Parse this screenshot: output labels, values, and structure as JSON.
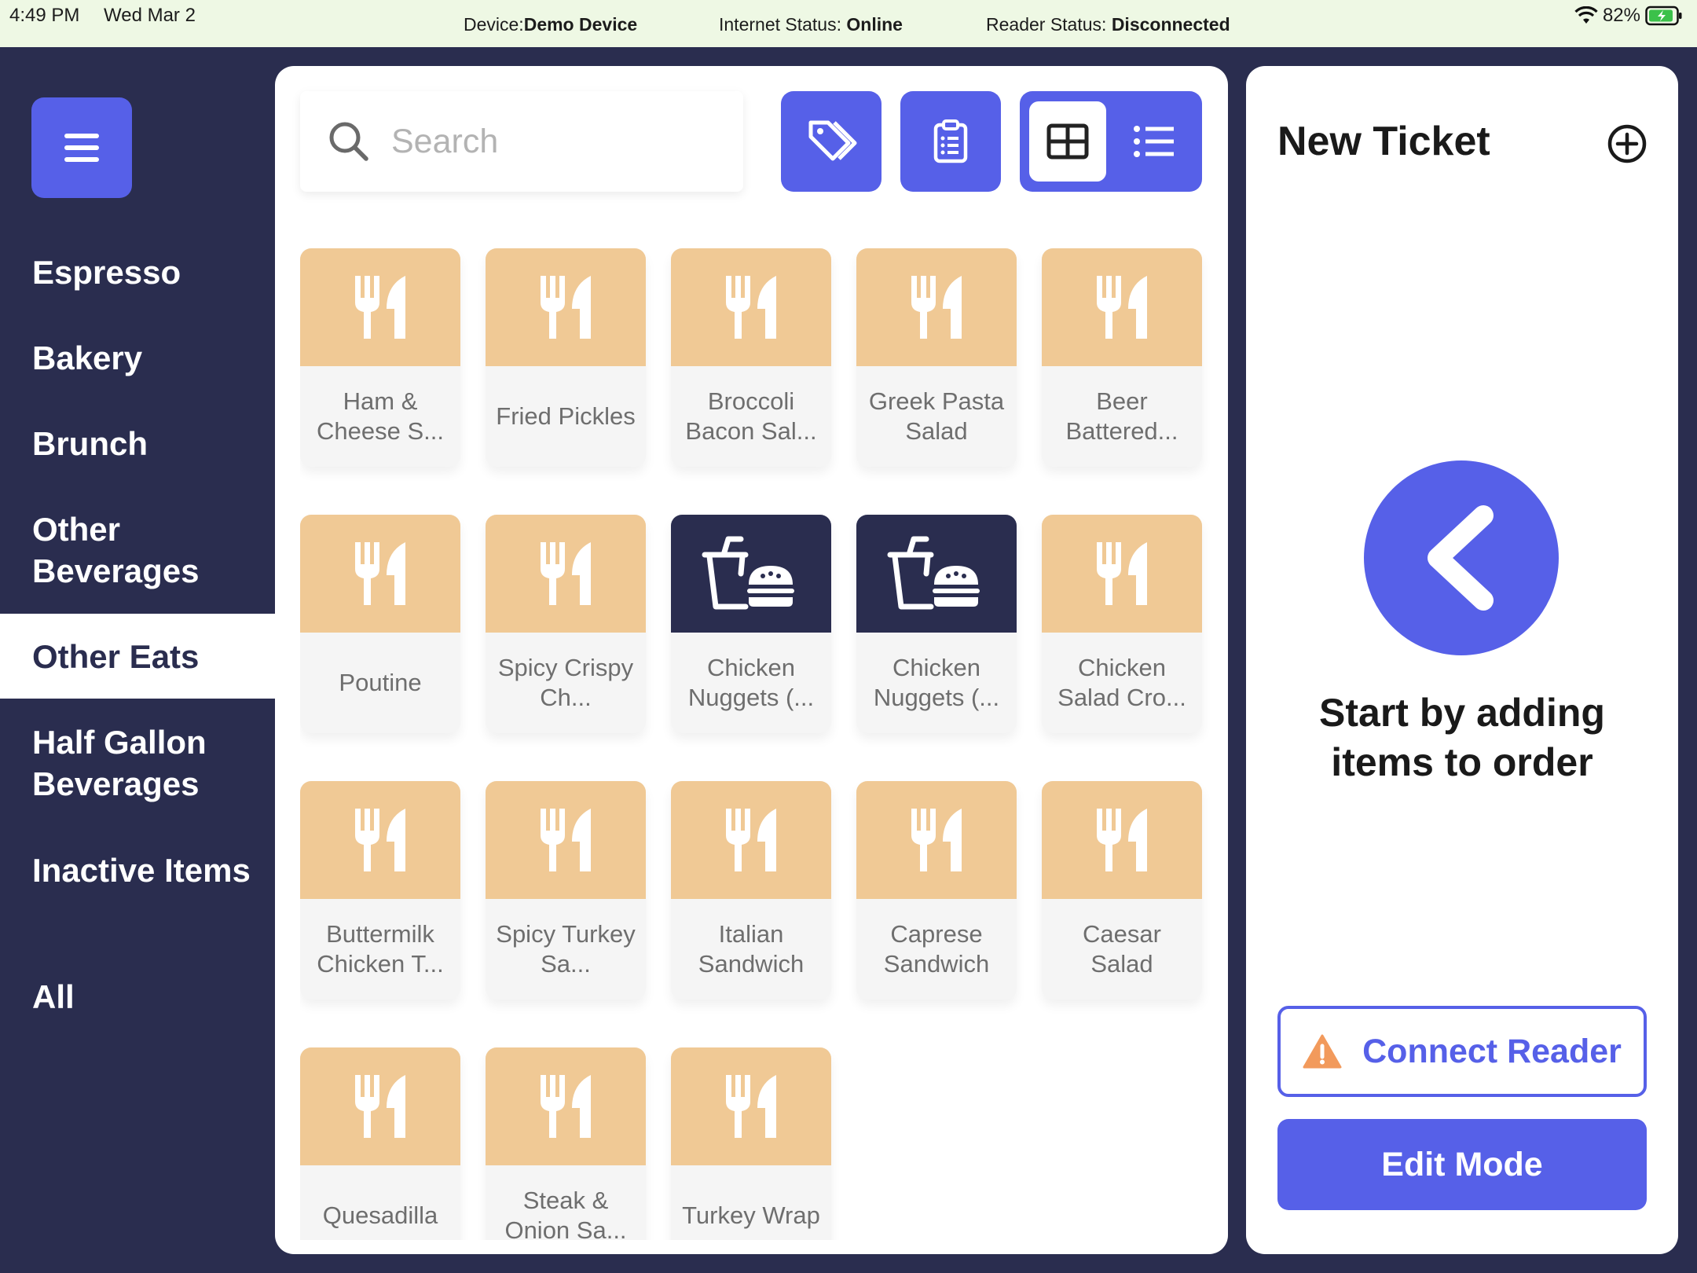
{
  "status_bar": {
    "time": "4:49 PM",
    "date": "Wed Mar 2",
    "device_label": "Device:",
    "device_value": "Demo Device",
    "internet_label": "Internet Status: ",
    "internet_value": "Online",
    "reader_label": "Reader Status: ",
    "reader_value": "Disconnected",
    "battery": "82%"
  },
  "sidebar": {
    "menu_icon": "hamburger-icon",
    "categories": [
      {
        "label": "Espresso"
      },
      {
        "label": "Bakery"
      },
      {
        "label": "Brunch"
      },
      {
        "label": "Other Beverages"
      },
      {
        "label": "Other Eats",
        "active": true
      },
      {
        "label": "Half Gallon Beverages"
      },
      {
        "label": "Inactive Items"
      },
      {
        "label": "All"
      }
    ]
  },
  "toolbar": {
    "search_placeholder": "Search",
    "icons": [
      "search-icon",
      "tag-icon",
      "clipboard-icon",
      "grid-view-icon",
      "list-view-icon"
    ]
  },
  "items": [
    {
      "name": "Ham & Cheese S...",
      "icon": "utensils-icon"
    },
    {
      "name": "Fried Pickles",
      "icon": "utensils-icon"
    },
    {
      "name": "Broccoli Bacon Sal...",
      "icon": "utensils-icon"
    },
    {
      "name": "Greek Pasta Salad",
      "icon": "utensils-icon"
    },
    {
      "name": "Beer Battered...",
      "icon": "utensils-icon"
    },
    {
      "name": "Poutine",
      "icon": "utensils-icon"
    },
    {
      "name": "Spicy Crispy Ch...",
      "icon": "utensils-icon"
    },
    {
      "name": "Chicken Nuggets (...",
      "icon": "fast-food-icon"
    },
    {
      "name": "Chicken Nuggets (...",
      "icon": "fast-food-icon"
    },
    {
      "name": "Chicken Salad Cro...",
      "icon": "utensils-icon"
    },
    {
      "name": "Buttermilk Chicken T...",
      "icon": "utensils-icon"
    },
    {
      "name": "Spicy Turkey Sa...",
      "icon": "utensils-icon"
    },
    {
      "name": "Italian Sandwich",
      "icon": "utensils-icon"
    },
    {
      "name": "Caprese Sandwich",
      "icon": "utensils-icon"
    },
    {
      "name": "Caesar Salad",
      "icon": "utensils-icon"
    },
    {
      "name": "Quesadilla",
      "icon": "utensils-icon"
    },
    {
      "name": "Steak & Onion Sa...",
      "icon": "utensils-icon"
    },
    {
      "name": "Turkey Wrap",
      "icon": "utensils-icon"
    }
  ],
  "ticket": {
    "title": "New Ticket",
    "empty_message": "Start by adding items to order",
    "connect_reader_label": "Connect Reader",
    "edit_mode_label": "Edit Mode",
    "colors": {
      "accent": "#5660e8",
      "sidebar": "#2a2d4f",
      "food_tile": "#f0c995",
      "warning": "#f29a5c"
    }
  }
}
